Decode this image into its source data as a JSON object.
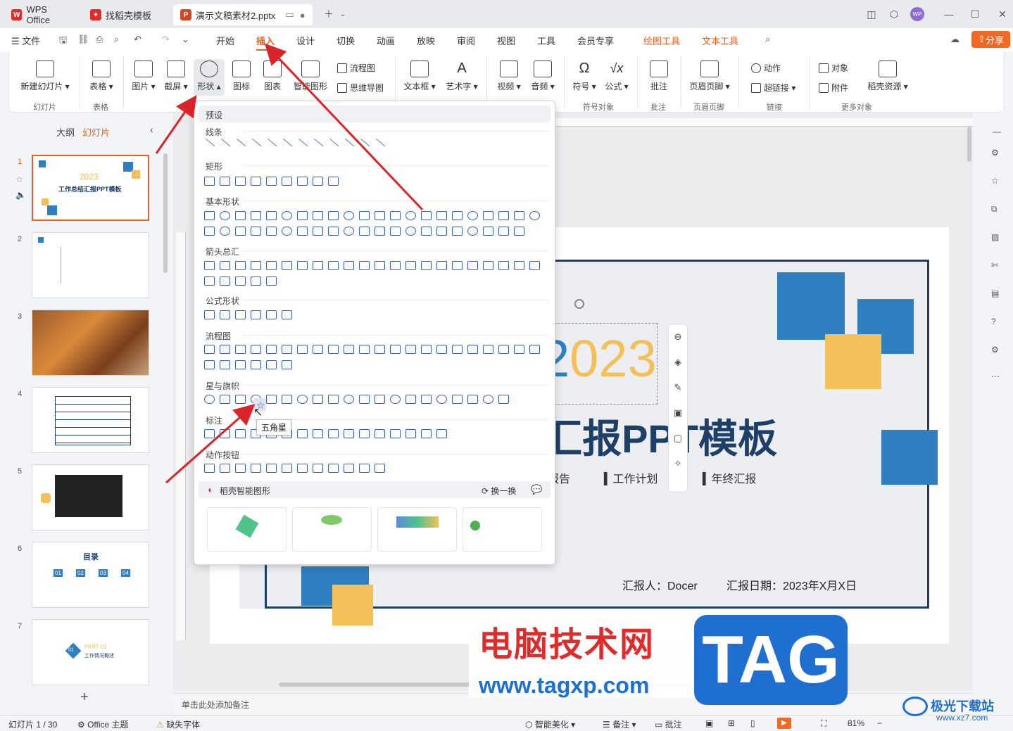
{
  "tabs": [
    {
      "label": "WPS Office",
      "icon_color": "#e02b2b"
    },
    {
      "label": "找稻壳模板",
      "icon_color": "#e02b2b"
    },
    {
      "label": "演示文稿素材2.pptx",
      "icon_color": "#d24726"
    }
  ],
  "menu": {
    "file": "文件",
    "items": [
      "开始",
      "插入",
      "设计",
      "切换",
      "动画",
      "放映",
      "审阅",
      "视图",
      "工具",
      "会员专享"
    ],
    "context": [
      "绘图工具",
      "文本工具"
    ],
    "active": "插入",
    "share": "分享"
  },
  "ribbon": {
    "new_slide": "新建幻灯片",
    "table": "表格",
    "picture": "图片",
    "screenshot": "截屏",
    "shape": "形状",
    "icon": "图标",
    "chart": "图表",
    "smart": "智能图形",
    "flowchart": "流程图",
    "mindmap": "思维导图",
    "textbox": "文本框",
    "wordart": "艺术字",
    "video": "视频",
    "audio": "音频",
    "symbol": "符号",
    "formula": "公式",
    "comment": "批注",
    "headerfooter": "页眉页脚",
    "action": "动作",
    "hyperlink": "超链接",
    "object": "对象",
    "attach": "附件",
    "docer": "稻壳资源",
    "groups": {
      "slide": "幻灯片",
      "table": "表格",
      "symbol": "符号对象",
      "comment": "批注",
      "headerfooter": "页眉页脚",
      "link": "链接",
      "more": "更多对象"
    }
  },
  "panel": {
    "outline": "大纲",
    "slides": "幻灯片",
    "active_view": "幻灯片"
  },
  "slides": [
    {
      "num": "1",
      "title": "工作总结汇报PPT模板",
      "year": "2023"
    },
    {
      "num": "2"
    },
    {
      "num": "3"
    },
    {
      "num": "4"
    },
    {
      "num": "5"
    },
    {
      "num": "6",
      "title": "目录",
      "items": [
        "01",
        "02",
        "03",
        "04"
      ]
    },
    {
      "num": "7",
      "part": "PART 01",
      "sub": "工作情况概述",
      "badge": "01"
    }
  ],
  "dropdown": {
    "preset": "预设",
    "sections": [
      "线条",
      "矩形",
      "基本形状",
      "箭头总汇",
      "公式形状",
      "流程图",
      "星与旗帜",
      "标注",
      "动作按钮"
    ],
    "tooltip": "五角星",
    "smart_title": "稻壳智能图形",
    "refresh": "换一换"
  },
  "main_slide": {
    "year": "2023",
    "title": "工作总结汇报PPT模板",
    "tags": [
      "述职报告",
      "工作计划",
      "年终汇报"
    ],
    "reporter": "汇报人：Docer",
    "date": "汇报日期：2023年X月X日"
  },
  "notes_placeholder": "单击此处添加备注",
  "watermark": {
    "cn": "电脑技术网",
    "url": "www.tagxp.com",
    "tag": "TAG",
    "site2": "极光下载站",
    "site2_url": "www.xz7.com"
  },
  "status": {
    "slide": "幻灯片 1 / 30",
    "theme": "Office 主题",
    "font": "缺失字体",
    "beautify": "智能美化",
    "notes": "备注",
    "comment": "批注",
    "zoom": "81%"
  },
  "colors": {
    "accent": "#e8611f",
    "blue": "#2f7fc1",
    "yellow": "#f3c05a",
    "navy": "#1e3f66"
  }
}
